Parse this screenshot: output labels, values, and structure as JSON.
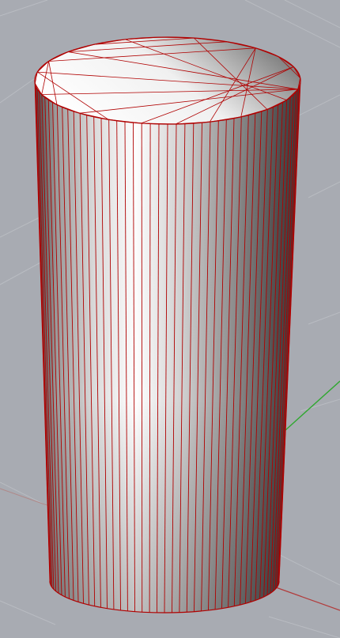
{
  "viewport": {
    "title": "",
    "object": "cylinder",
    "render_mode": "shaded-with-mesh-wireframe",
    "background_color": "#a8abb2",
    "grid_color": "#b9bcc2",
    "axis_x_color": "#b23b3b",
    "axis_y_color": "#2fa82f",
    "wire_color": "#b00000",
    "side_segments": 96
  }
}
